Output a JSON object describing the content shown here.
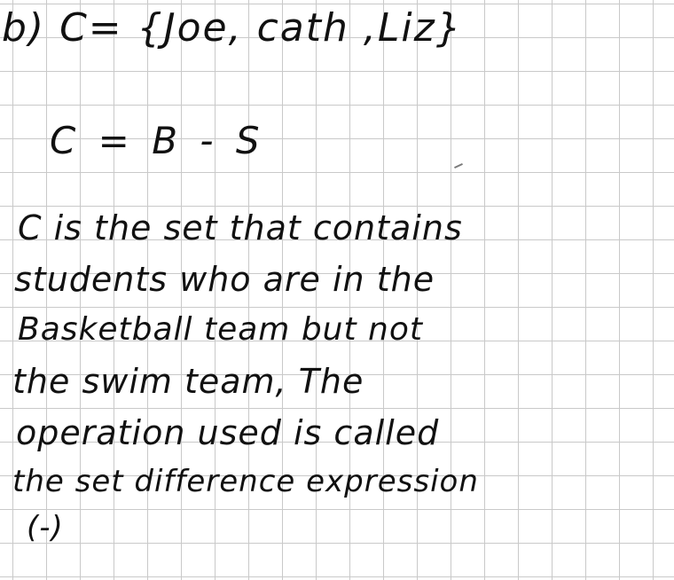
{
  "paper": {
    "grid_color": "#c9c9c9",
    "ink_color": "#111111"
  },
  "answer": {
    "set_definition": "b) C= {Joe, cath ,Liz}",
    "equation": "C = B - S",
    "explanation_lines": [
      "C is the set that contains",
      "students who are in the",
      "Basketball team but not",
      "the swim team, The",
      "operation used is called",
      "the set difference expression",
      "(-)"
    ]
  }
}
